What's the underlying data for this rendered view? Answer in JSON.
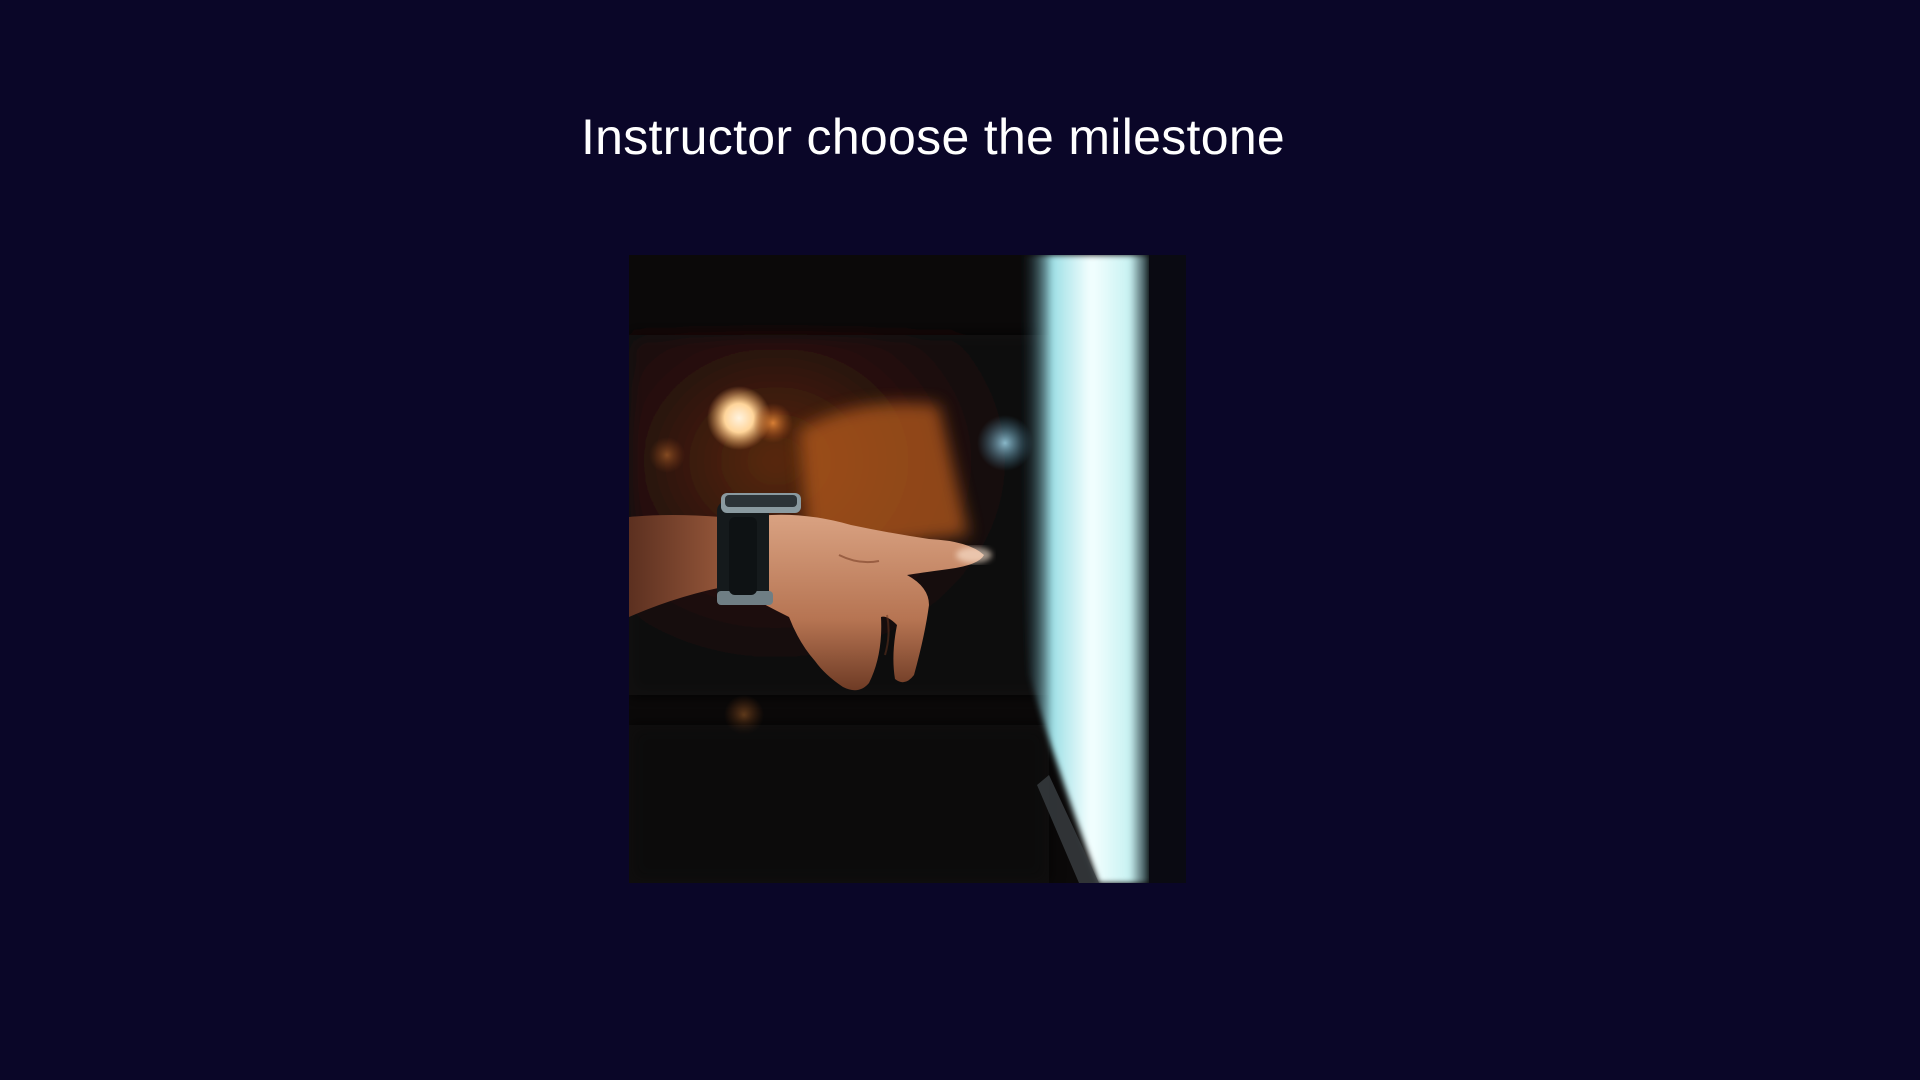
{
  "slide": {
    "title": "Instructor choose the milestone"
  },
  "colors": {
    "background": "#0a0628",
    "title_text": "#ffffff"
  },
  "image": {
    "subject": "hand-pointing-at-glowing-screen"
  }
}
